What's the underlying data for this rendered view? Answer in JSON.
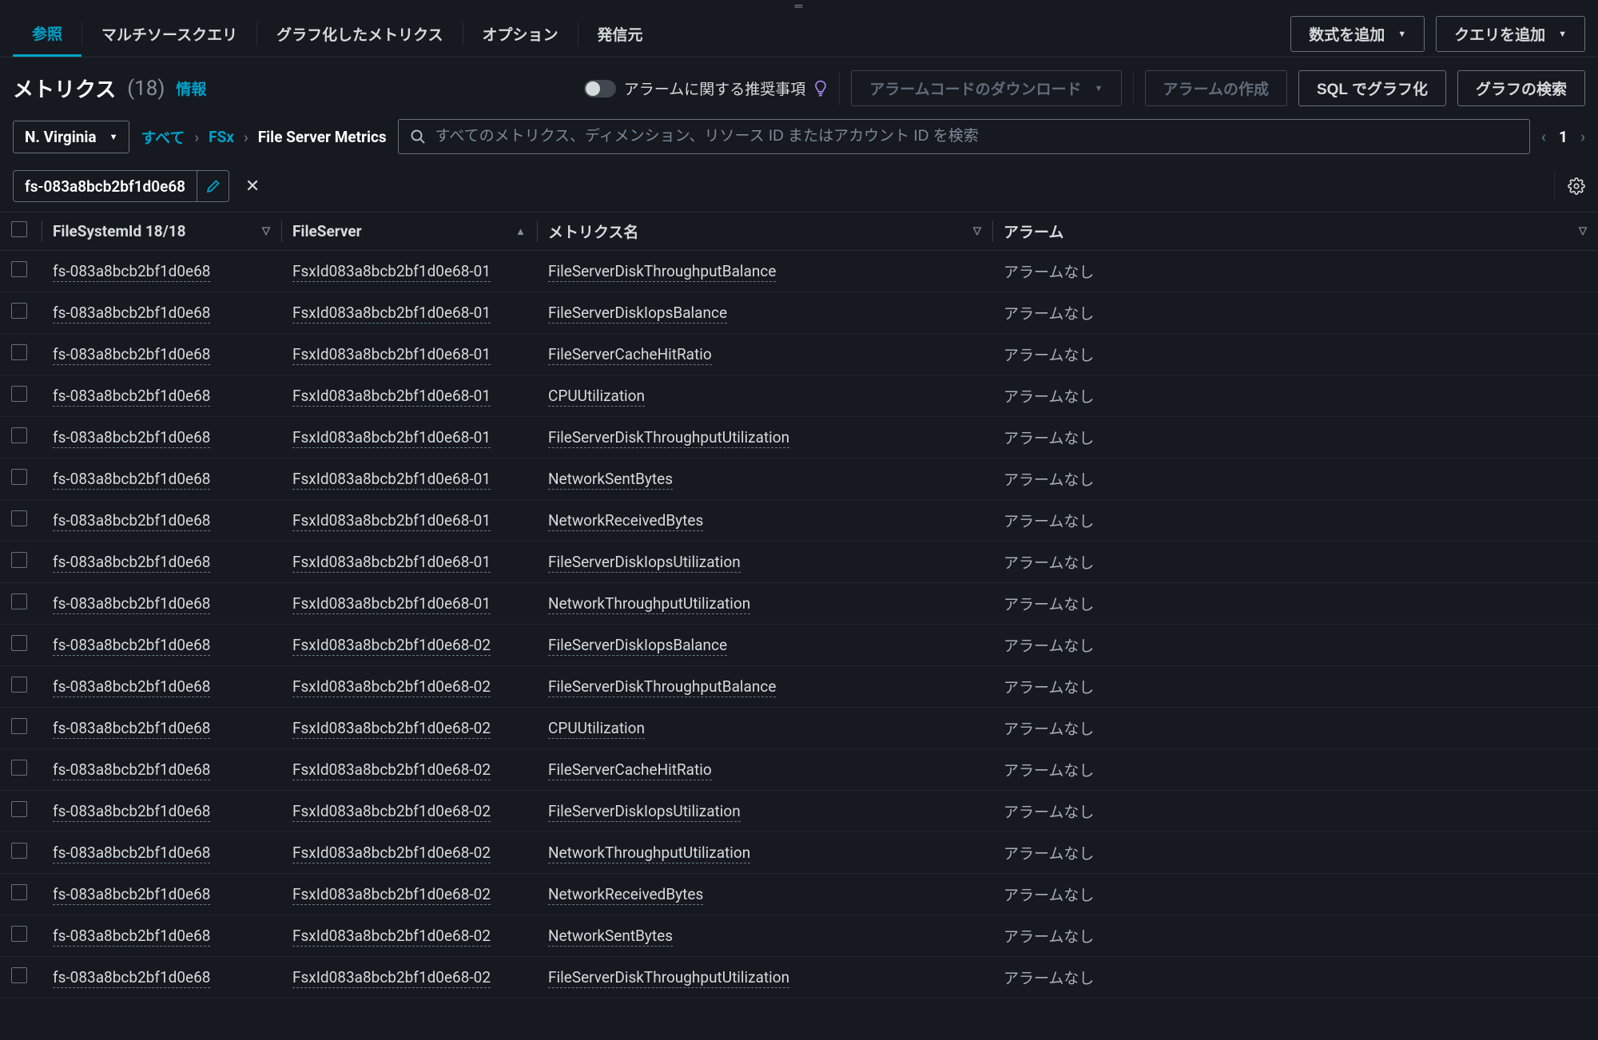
{
  "tabs": {
    "browse": "参照",
    "multi_source": "マルチソースクエリ",
    "graphed": "グラフ化したメトリクス",
    "options": "オプション",
    "source": "発信元"
  },
  "top_actions": {
    "add_formula": "数式を追加",
    "add_query": "クエリを追加"
  },
  "section": {
    "title": "メトリクス",
    "count": "(18)",
    "info": "情報"
  },
  "alarm_bar": {
    "toggle_label": "アラームに関する推奨事項",
    "download": "アラームコードのダウンロード",
    "create": "アラームの作成",
    "sql_graph": "SQL でグラフ化",
    "search_graph": "グラフの検索"
  },
  "region": "N. Virginia",
  "breadcrumb": {
    "all": "すべて",
    "fsx": "FSx",
    "current": "File Server Metrics"
  },
  "search": {
    "placeholder": "すべてのメトリクス、ディメンション、リソース ID またはアカウント ID を検索"
  },
  "pager": {
    "page": "1"
  },
  "filter_chip": {
    "value": "fs-083a8bcb2bf1d0e68"
  },
  "columns": {
    "filesystem": "FileSystemId 18/18",
    "fileserver": "FileServer",
    "metric": "メトリクス名",
    "alarm": "アラーム"
  },
  "alarm_none": "アラームなし",
  "rows": [
    {
      "fs": "fs-083a8bcb2bf1d0e68",
      "server": "FsxId083a8bcb2bf1d0e68-01",
      "metric": "FileServerDiskThroughputBalance"
    },
    {
      "fs": "fs-083a8bcb2bf1d0e68",
      "server": "FsxId083a8bcb2bf1d0e68-01",
      "metric": "FileServerDiskIopsBalance"
    },
    {
      "fs": "fs-083a8bcb2bf1d0e68",
      "server": "FsxId083a8bcb2bf1d0e68-01",
      "metric": "FileServerCacheHitRatio"
    },
    {
      "fs": "fs-083a8bcb2bf1d0e68",
      "server": "FsxId083a8bcb2bf1d0e68-01",
      "metric": "CPUUtilization"
    },
    {
      "fs": "fs-083a8bcb2bf1d0e68",
      "server": "FsxId083a8bcb2bf1d0e68-01",
      "metric": "FileServerDiskThroughputUtilization"
    },
    {
      "fs": "fs-083a8bcb2bf1d0e68",
      "server": "FsxId083a8bcb2bf1d0e68-01",
      "metric": "NetworkSentBytes"
    },
    {
      "fs": "fs-083a8bcb2bf1d0e68",
      "server": "FsxId083a8bcb2bf1d0e68-01",
      "metric": "NetworkReceivedBytes"
    },
    {
      "fs": "fs-083a8bcb2bf1d0e68",
      "server": "FsxId083a8bcb2bf1d0e68-01",
      "metric": "FileServerDiskIopsUtilization"
    },
    {
      "fs": "fs-083a8bcb2bf1d0e68",
      "server": "FsxId083a8bcb2bf1d0e68-01",
      "metric": "NetworkThroughputUtilization"
    },
    {
      "fs": "fs-083a8bcb2bf1d0e68",
      "server": "FsxId083a8bcb2bf1d0e68-02",
      "metric": "FileServerDiskIopsBalance"
    },
    {
      "fs": "fs-083a8bcb2bf1d0e68",
      "server": "FsxId083a8bcb2bf1d0e68-02",
      "metric": "FileServerDiskThroughputBalance"
    },
    {
      "fs": "fs-083a8bcb2bf1d0e68",
      "server": "FsxId083a8bcb2bf1d0e68-02",
      "metric": "CPUUtilization"
    },
    {
      "fs": "fs-083a8bcb2bf1d0e68",
      "server": "FsxId083a8bcb2bf1d0e68-02",
      "metric": "FileServerCacheHitRatio"
    },
    {
      "fs": "fs-083a8bcb2bf1d0e68",
      "server": "FsxId083a8bcb2bf1d0e68-02",
      "metric": "FileServerDiskIopsUtilization"
    },
    {
      "fs": "fs-083a8bcb2bf1d0e68",
      "server": "FsxId083a8bcb2bf1d0e68-02",
      "metric": "NetworkThroughputUtilization"
    },
    {
      "fs": "fs-083a8bcb2bf1d0e68",
      "server": "FsxId083a8bcb2bf1d0e68-02",
      "metric": "NetworkReceivedBytes"
    },
    {
      "fs": "fs-083a8bcb2bf1d0e68",
      "server": "FsxId083a8bcb2bf1d0e68-02",
      "metric": "NetworkSentBytes"
    },
    {
      "fs": "fs-083a8bcb2bf1d0e68",
      "server": "FsxId083a8bcb2bf1d0e68-02",
      "metric": "FileServerDiskThroughputUtilization"
    }
  ]
}
